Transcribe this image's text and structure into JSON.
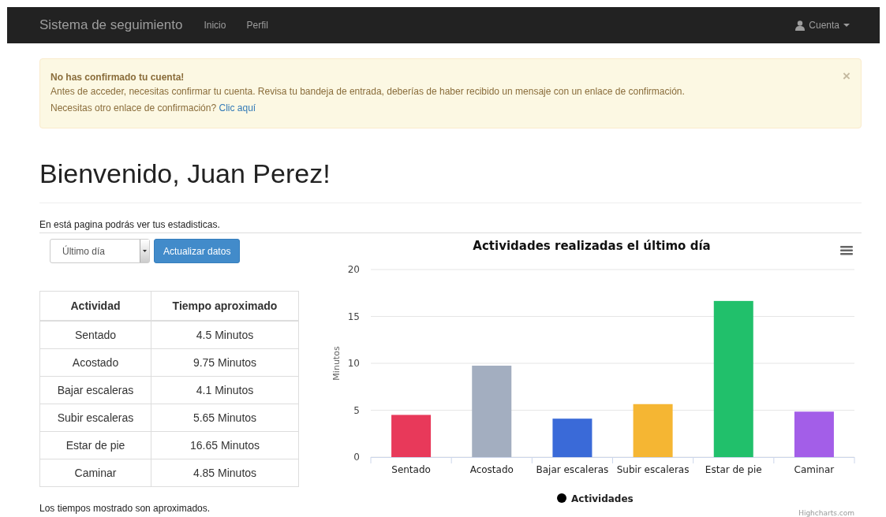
{
  "navbar": {
    "brand": "Sistema de seguimiento",
    "links": [
      {
        "label": "Inicio"
      },
      {
        "label": "Perfil"
      }
    ],
    "account": "Cuenta"
  },
  "alert": {
    "title": "No has confirmado tu cuenta!",
    "message": "Antes de acceder, necesitas confirmar tu cuenta. Revisa tu bandeja de entrada, deberías de haber recibido un mensaje con un enlace de confirmación.",
    "question": "Necesitas otro enlace de confirmación?",
    "link": "Clic aquí",
    "close": "×"
  },
  "heading": "Bienvenido, Juan Perez!",
  "intro": "En está pagina podrás ver tus estadisticas.",
  "period_select": {
    "value": "Último día"
  },
  "update_button": "Actualizar datos",
  "table": {
    "columns": [
      "Actividad",
      "Tiempo aproximado"
    ],
    "rows": [
      [
        "Sentado",
        "4.5 Minutos"
      ],
      [
        "Acostado",
        "9.75 Minutos"
      ],
      [
        "Bajar escaleras",
        "4.1 Minutos"
      ],
      [
        "Subir escaleras",
        "5.65 Minutos"
      ],
      [
        "Estar de pie",
        "16.65 Minutos"
      ],
      [
        "Caminar",
        "4.85 Minutos"
      ]
    ]
  },
  "footnote": "Los tiempos mostrado son aproximados.",
  "chart": {
    "chart_data": {
      "type": "bar",
      "title": "Actividades realizadas el último día",
      "ylabel": "Minutos",
      "categories": [
        "Sentado",
        "Acostado",
        "Bajar escaleras",
        "Subir escaleras",
        "Estar de pie",
        "Caminar"
      ],
      "series": [
        {
          "name": "Actividades",
          "values": [
            4.5,
            9.75,
            4.1,
            5.65,
            16.65,
            4.85
          ],
          "colors": [
            "#e8395a",
            "#a3aec0",
            "#3a6ad8",
            "#f5b633",
            "#21c06b",
            "#a35ee8"
          ]
        }
      ],
      "ylim": [
        0,
        20
      ],
      "yticks": [
        0,
        5,
        10,
        15,
        20
      ],
      "grid": true
    },
    "credits": "Highcharts.com"
  }
}
